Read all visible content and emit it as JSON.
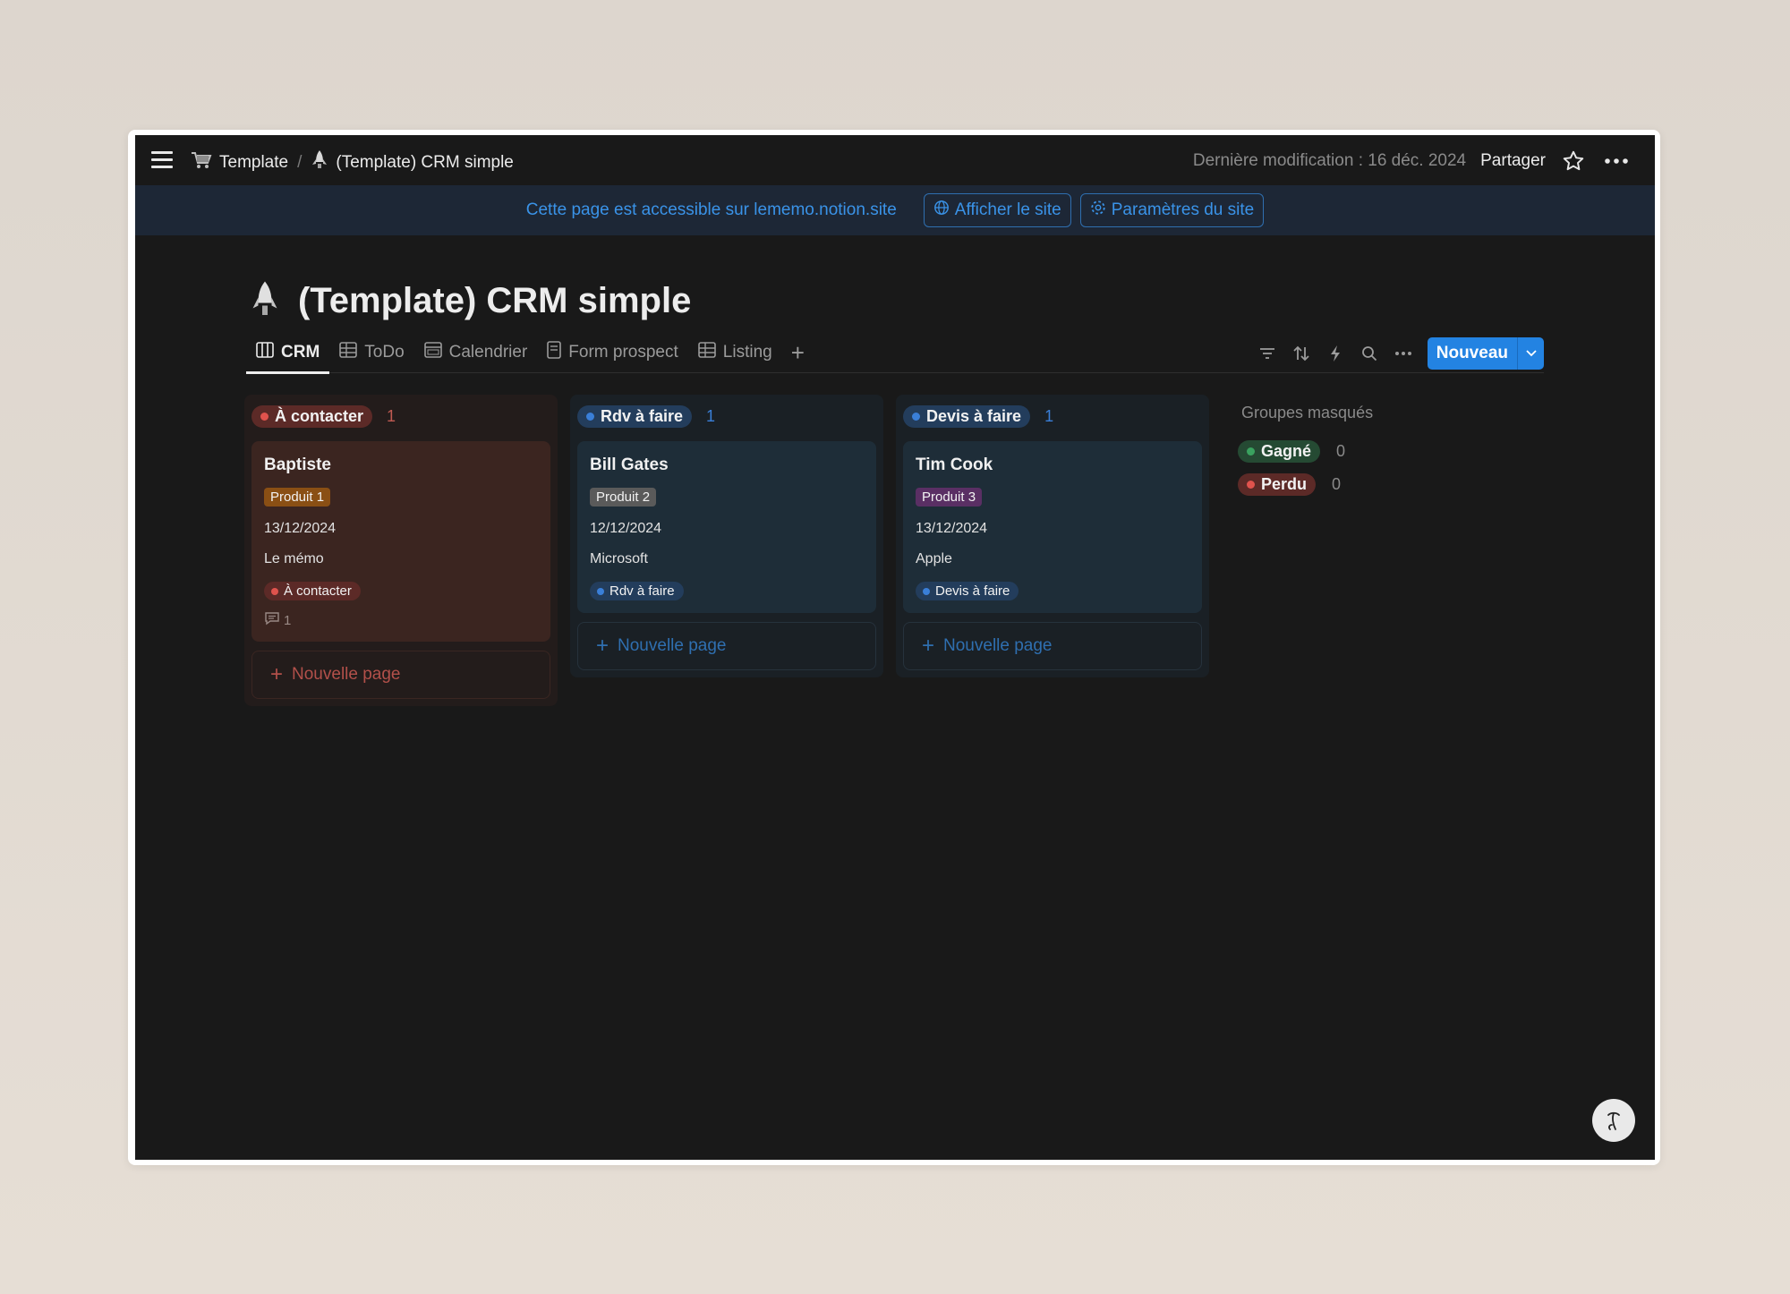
{
  "topbar": {
    "breadcrumb": [
      {
        "icon": "cart-icon",
        "label": "Template"
      },
      {
        "icon": "rocket-icon",
        "label": "(Template) CRM simple"
      }
    ],
    "separator": "/",
    "last_edit": "Dernière modification : 16 déc. 2024",
    "share_label": "Partager"
  },
  "banner": {
    "text": "Cette page est accessible sur lememo.notion.site",
    "view_site": "Afficher le site",
    "site_settings": "Paramètres du site"
  },
  "page": {
    "icon": "rocket-icon",
    "title": "(Template) CRM simple"
  },
  "tabs": [
    {
      "label": "CRM",
      "icon": "board-icon",
      "active": true
    },
    {
      "label": "ToDo",
      "icon": "table-icon"
    },
    {
      "label": "Calendrier",
      "icon": "calendar-icon"
    },
    {
      "label": "Form prospect",
      "icon": "form-icon"
    },
    {
      "label": "Listing",
      "icon": "table-icon"
    }
  ],
  "toolbar": {
    "new_label": "Nouveau"
  },
  "columns": [
    {
      "label": "À contacter",
      "count": "1",
      "cards": [
        {
          "title": "Baptiste",
          "product": "Produit 1",
          "date": "13/12/2024",
          "company": "Le mémo",
          "status": "À contacter",
          "comments": "1"
        }
      ],
      "new_page": "Nouvelle page"
    },
    {
      "label": "Rdv à faire",
      "count": "1",
      "cards": [
        {
          "title": "Bill Gates",
          "product": "Produit 2",
          "date": "12/12/2024",
          "company": "Microsoft",
          "status": "Rdv à faire"
        }
      ],
      "new_page": "Nouvelle page"
    },
    {
      "label": "Devis à faire",
      "count": "1",
      "cards": [
        {
          "title": "Tim Cook",
          "product": "Produit 3",
          "date": "13/12/2024",
          "company": "Apple",
          "status": "Devis à faire"
        }
      ],
      "new_page": "Nouvelle page"
    }
  ],
  "hidden_groups": {
    "title": "Groupes masqués",
    "groups": [
      {
        "label": "Gagné",
        "count": "0"
      },
      {
        "label": "Perdu",
        "count": "0"
      }
    ]
  },
  "colors": {
    "accent": "#2383e2",
    "red": "#e0534d",
    "blue": "#3a7fd8",
    "green": "#3aa25f"
  }
}
